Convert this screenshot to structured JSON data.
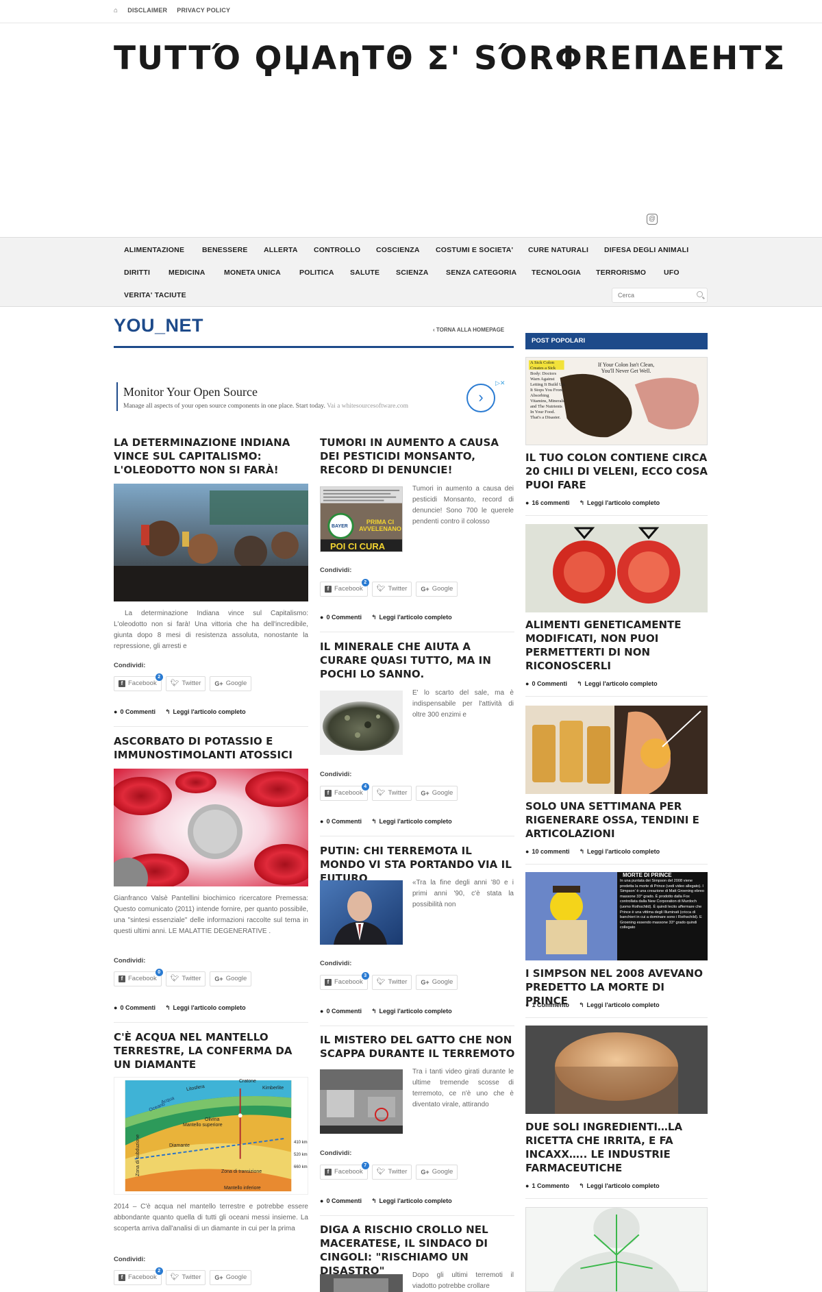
{
  "topbar": {
    "home_icon": "home-icon",
    "disclaimer": "DISCLAIMER",
    "privacy": "PRIVACY POLICY"
  },
  "site": {
    "title": "TUTTO QUANTO È SORPRENDENTE"
  },
  "site_title_display": "TUTTΌ ϘЏAηTΘ Σ' ЅΌRΦREΠΔΕΗΤΣ",
  "nav": {
    "row1": [
      "ALIMENTAZIONE",
      "BENESSERE",
      "ALLERTA",
      "CONTROLLO",
      "COSCIENZA",
      "COSTUMI E SOCIETA'",
      "CURE NATURALI",
      "DIFESA DEGLI ANIMALI"
    ],
    "row2": [
      "DIRITTI",
      "MEDICINA",
      "MONETA UNICA",
      "POLITICA",
      "SALUTE",
      "SCIENZA",
      "SENZA CATEGORIA",
      "TECNOLOGIA",
      "TERRORISMO",
      "UFO"
    ],
    "row3": [
      "VERITA' TACIUTE"
    ],
    "search_placeholder": "Cerca"
  },
  "section": {
    "title": "YOU_NET",
    "back": "‹  TORNA ALLA HOMEPAGE"
  },
  "ad": {
    "title": "Monitor Your Open Source",
    "text": "Manage all aspects of your open source components in one place. Start today.",
    "via": "Vai a whitesourcesoftware.com",
    "arrow": "›",
    "choices": "▷✕"
  },
  "share": {
    "label": "Condividi:",
    "facebook": "Facebook",
    "twitter": "Twitter",
    "google": "Google"
  },
  "meta": {
    "read_more": "Leggi l'articolo completo"
  },
  "articles_left": [
    {
      "title": "LA DETERMINAZIONE INDIANA VINCE SUL CAPITALISMO: L'OLEODOTTO NON SI FARÀ!",
      "excerpt": "La determinazione Indiana vince sul Capitalismo: L'oleodotto non si farà!   Una vittoria che ha dell'incredibile, giunta dopo 8 mesi di resistenza assoluta, nonostante la repressione, gli arresti e",
      "fb_count": "2",
      "comments": "0 Commenti"
    },
    {
      "title": "ASCORBATO DI POTASSIO E IMMUNOSTIMOLANTI ATOSSICI",
      "excerpt": "Gianfranco Valsè Pantellini biochimico ricercatore Premessa: Questo comunicato (2011) intende fornire, per quanto possibile, una \"sintesi essenziale\" delle informazioni raccolte sul tema in questi ultimi anni. LE MALATTIE DEGENERATIVE .",
      "fb_count": "0",
      "comments": "0 Commenti"
    },
    {
      "title": "C'È ACQUA NEL MANTELLO TERRESTRE, LA CONFERMA DA UN DIAMANTE",
      "excerpt": "2014 – C'è acqua nel mantello terrestre e potrebbe essere abbondante quanto quella di tutti gli oceani messi insieme. La scoperta arriva dall'analisi di un diamante in cui per la prima",
      "fb_count": "2",
      "comments": "0 Commenti"
    }
  ],
  "articles_mid": [
    {
      "title": "TUMORI IN AUMENTO A CAUSA DEI PESTICIDI MONSANTO, RECORD DI DENUNCIE!",
      "excerpt": "Tumori in aumento a causa dei pesticidi Monsanto, record di denuncie! Sono 700 le querele pendenti contro il colosso",
      "img_text_top": "PRIMA CI AVVELENANO",
      "img_text_bottom": "POI CI CURA",
      "img_logo": "BAYER",
      "fb_count": "2",
      "comments": "0 Commenti"
    },
    {
      "title": "IL MINERALE CHE AIUTA A CURARE QUASI TUTTO, MA IN POCHI LO SANNO.",
      "excerpt": "E' lo scarto del sale, ma è indispensabile per l'attività di oltre 300 enzimi e",
      "fb_count": "4",
      "comments": "0 Commenti"
    },
    {
      "title": "PUTIN: CHI TERREMOTA IL MONDO VI STA PORTANDO VIA IL FUTURO",
      "excerpt": "«Tra la fine degli anni '80 e i primi anni '90, c'è stata la possibilità non",
      "fb_count": "3",
      "comments": "0 Commenti"
    },
    {
      "title": "IL MISTERO DEL GATTO CHE NON SCAPPA DURANTE IL TERREMOTO",
      "excerpt": "Tra i tanti video girati durante le ultime tremende scosse di terremoto, ce n'è uno che è diventato virale, attirando",
      "fb_count": "7",
      "comments": "0 Commenti"
    },
    {
      "title": "DIGA A RISCHIO CROLLO NEL MACERATESE, IL SINDACO DI CINGOLI: \"RISCHIAMO UN DISASTRO\"",
      "excerpt": "Dopo gli ultimi terremoti il viadotto potrebbe crollare"
    }
  ],
  "sidebar": {
    "header": "POST POPOLARI",
    "posts": [
      {
        "title": "IL TUO COLON CONTIENE CIRCA 20 CHILI DI VELENI, ECCO COSA PUOI FARE",
        "comments": "16 commenti",
        "img_text_left": "A Sick Colon Creates a Sick Body: Doctors Warn Against Letting It Build Up. It Stops You From Absorbing Vitamins, Minerals and The Nutrients In Your Food. That's a Disaster.",
        "img_text_right": "If Your Colon Isn't Clean, You'll Never Get Well."
      },
      {
        "title": "ALIMENTI GENETICAMENTE MODIFICATI, NON PUOI PERMETTERTI DI NON RICONOSCERLI",
        "comments": "0 Commenti"
      },
      {
        "title": "SOLO UNA SETTIMANA PER RIGENERARE OSSA, TENDINI E ARTICOLAZIONI",
        "comments": "10 commenti"
      },
      {
        "title": "I SIMPSON NEL 2008 AVEVANO PREDETTO LA MORTE DI PRINCE",
        "comments": "1 Commento",
        "img_caption_title": "MORTE DI PRINCE",
        "img_caption": "In una puntata dei Simpson del 2008 viene predetta la morte di Prince (vedi video allegato). I Simpson' è una creazione di Matt Groening ebreo massone 33° grado. È prodotto dalla Fox controllata dalla New Corporation di Murdoch (uomo Rothschild). È quindi lecito affermare che Prince è una vittima degli Illuminati (cricca di banchieri in cui a dominare sono i Rothschild). E Groening essendo massone 33° grado quindi collegato"
      },
      {
        "title": "DUE SOLI INGREDIENTI…LA RICETTA CHE IRRITA, E FA INCAXX….. LE INDUSTRIE FARMACEUTICHE",
        "comments": "1 Commento"
      }
    ]
  },
  "diagram_labels": {
    "oceano": "Oceano",
    "acqua": "Acqua",
    "litosfera": "Litosfera",
    "cratone": "Cratone",
    "kimberlite": "Kimberlite",
    "mantello_sup": "Mantello superiore",
    "olivina": "Olivina",
    "diamante": "Diamante",
    "zona_trans": "Zona di transizione",
    "mantello_inf": "Mantello inferiore",
    "zona_sub": "Zona di subduzione",
    "km410": "410 km",
    "km520": "520 km",
    "km660": "660 km"
  },
  "colors": {
    "accent": "#1d4a8a",
    "nav_bg": "#f2f2f2",
    "badge": "#2a7bd2"
  }
}
